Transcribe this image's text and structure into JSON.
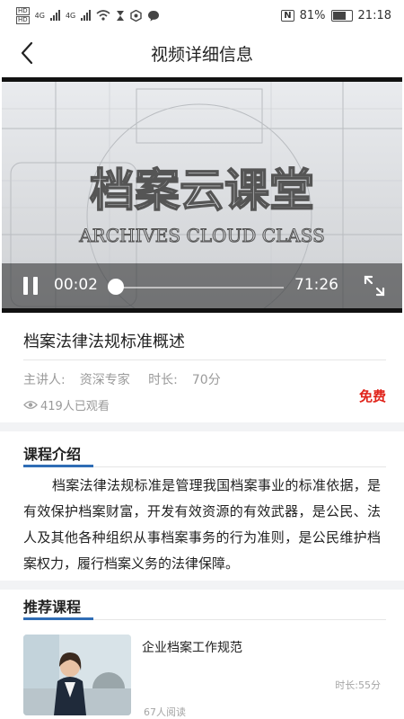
{
  "status_bar": {
    "network_badge_1": "HD",
    "network_badge_2": "HD",
    "signal_1": "4G",
    "signal_2": "4G",
    "nfc": "N",
    "battery_percent": "81%",
    "time": "21:18"
  },
  "header": {
    "title": "视频详细信息",
    "back_icon": "chevron-left-icon"
  },
  "player": {
    "current_time": "00:02",
    "duration": "71:26",
    "progress_fraction": 0.0005,
    "watermark_cn": "档案云课堂",
    "watermark_en": "ARCHIVES CLOUD CLASS",
    "pause_icon": "pause-icon",
    "fullscreen_icon": "fullscreen-icon"
  },
  "course": {
    "title": "档案法律法规标准概述",
    "lecturer_label": "主讲人:",
    "lecturer": "资深专家",
    "duration_label": "时长:",
    "duration": "70分",
    "views": "419人已观看",
    "price": "免费"
  },
  "intro": {
    "heading": "课程介绍",
    "text": "档案法律法规标准是管理我国档案事业的标准依据，是有效保护档案财富，开发有效资源的有效武器，是公民、法人及其他各种组织从事档案事务的行为准则，是公民维护档案权力，履行档案义务的法律保障。"
  },
  "recommend": {
    "heading": "推荐课程",
    "items": [
      {
        "title": "企业档案工作规范",
        "duration": "时长:55分",
        "reads": "67人阅读"
      }
    ]
  },
  "colors": {
    "accent": "#2f6db5",
    "price": "#e0231a"
  }
}
